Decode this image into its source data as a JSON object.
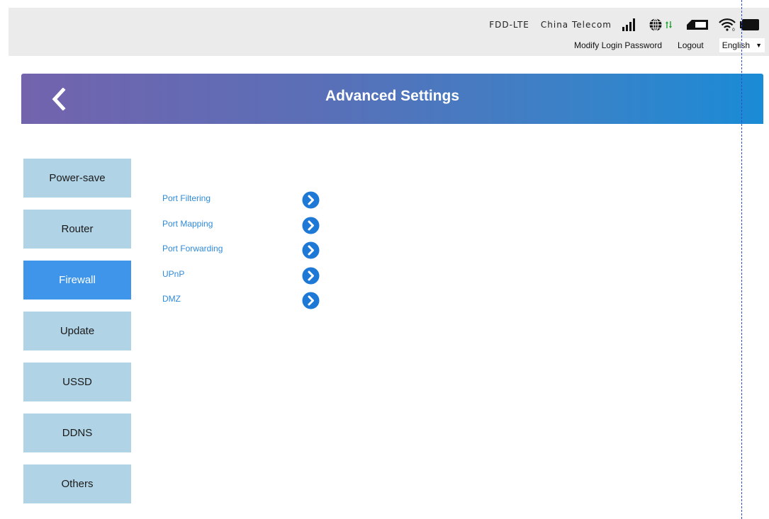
{
  "status": {
    "network_type": "FDD-LTE",
    "carrier": "China Telecom",
    "icons": [
      "signal-icon",
      "globe-icon",
      "sim-icon",
      "wifi-icon",
      "battery-icon"
    ],
    "data_arrow_color": "#1aa32b"
  },
  "top_links": {
    "modify_password": "Modify Login Password",
    "logout": "Logout",
    "language": "English"
  },
  "banner": {
    "title": "Advanced Settings",
    "back_icon": "chevron-left-icon"
  },
  "sidebar": {
    "items": [
      {
        "label": "Power-save",
        "active": false
      },
      {
        "label": "Router",
        "active": false
      },
      {
        "label": "Firewall",
        "active": true
      },
      {
        "label": "Update",
        "active": false
      },
      {
        "label": "USSD",
        "active": false
      },
      {
        "label": "DDNS",
        "active": false
      },
      {
        "label": "Others",
        "active": false
      }
    ]
  },
  "firewall_menu": {
    "items": [
      {
        "label": "Port Filtering",
        "icon": "chevron-right-circle-icon"
      },
      {
        "label": "Port Mapping",
        "icon": "chevron-right-circle-icon"
      },
      {
        "label": "Port Forwarding",
        "icon": "chevron-right-circle-icon"
      },
      {
        "label": "UPnP",
        "icon": "chevron-right-circle-icon"
      },
      {
        "label": "DMZ",
        "icon": "chevron-right-circle-icon"
      }
    ]
  },
  "colors": {
    "active_tab": "#3e95e9",
    "inactive_tab": "#b1d3e6",
    "link": "#2f8ad8",
    "arrow_button": "#1d78d6"
  }
}
